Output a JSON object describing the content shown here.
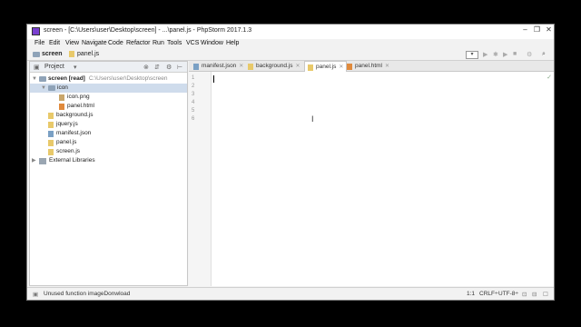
{
  "window": {
    "title": "screen - [C:\\Users\\user\\Desktop\\screen] - ...\\panel.js - PhpStorm 2017.1.3",
    "controls": [
      "–",
      "❐",
      "✕"
    ]
  },
  "menu": [
    "File",
    "Edit",
    "View",
    "Navigate",
    "Code",
    "Refactor",
    "Run",
    "Tools",
    "VCS",
    "Window",
    "Help"
  ],
  "breadcrumb": {
    "project": "screen",
    "file": "panel.js"
  },
  "project_panel": {
    "title": "Project",
    "tree": [
      {
        "label": "screen [read]",
        "path": "C:\\Users\\user\\Desktop\\screen"
      },
      {
        "label": "icon"
      },
      {
        "label": "icon.png"
      },
      {
        "label": "panel.html"
      },
      {
        "label": "background.js"
      },
      {
        "label": "jquery.js"
      },
      {
        "label": "manifest.json"
      },
      {
        "label": "panel.js"
      },
      {
        "label": "screen.js"
      },
      {
        "label": "External Libraries"
      }
    ]
  },
  "tabs": [
    {
      "label": "manifest.json"
    },
    {
      "label": "background.js"
    },
    {
      "label": "panel.js"
    },
    {
      "label": "panel.html"
    }
  ],
  "editor": {
    "line_numbers": [
      "1",
      "2",
      "3",
      "4",
      "5",
      "6"
    ]
  },
  "status": {
    "message": "Unused function imageDonwload",
    "position": "1:1",
    "line_sep": "CRLF÷",
    "encoding": "UTF-8÷"
  },
  "colors": {
    "selection": "#cfdcec",
    "app_icon": "#7a3fd0",
    "background": "#000000"
  }
}
